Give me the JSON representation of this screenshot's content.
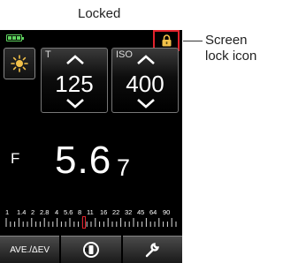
{
  "annotations": {
    "caption": "Locked",
    "lock_label_line1": "Screen",
    "lock_label_line2": "lock icon"
  },
  "device": {
    "lock_icon": "lock-icon",
    "mode_icon": "sun-icon",
    "shutter": {
      "label": "T",
      "value": "125"
    },
    "iso": {
      "label": "ISO",
      "value": "400"
    },
    "aperture": {
      "label": "F",
      "value": "5.6",
      "sub": "7"
    },
    "scale": [
      "1",
      "1.4",
      "2",
      "2.8",
      "4",
      "5.6",
      "8",
      "11",
      "16",
      "22",
      "32",
      "45",
      "64",
      "90"
    ],
    "buttons": {
      "ave": "AVE./ΔEV",
      "memory_icon": "memory-icon",
      "settings_icon": "wrench-icon"
    }
  },
  "colors": {
    "accent": "#e0222c",
    "battery": "#5fd35f",
    "mode_icon": "#f2c14a"
  }
}
